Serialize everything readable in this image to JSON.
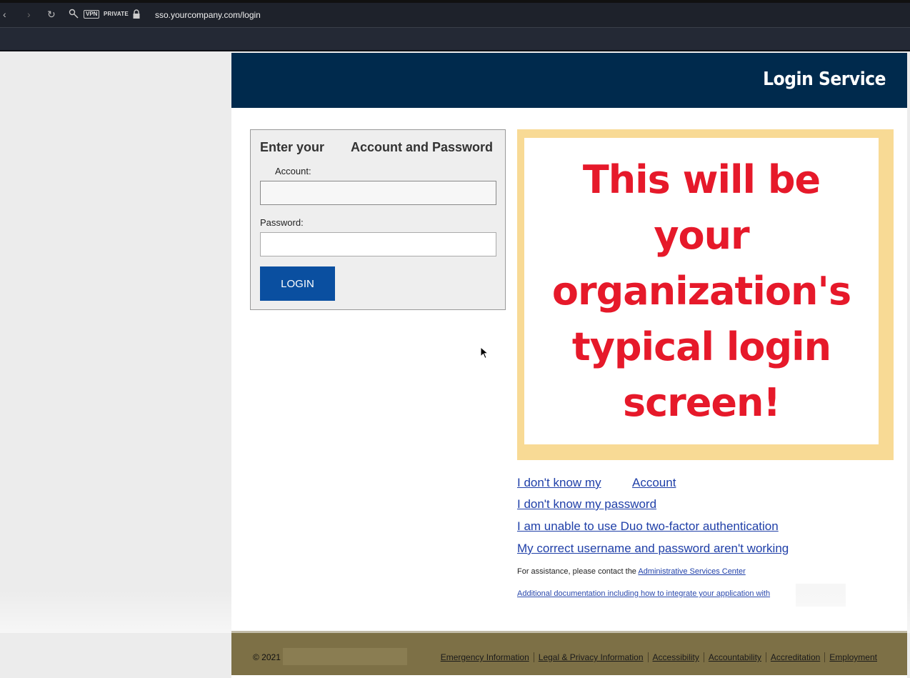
{
  "browser": {
    "vpn_label": "VPN",
    "private_label": "PRIVATE",
    "url": "sso.yourcompany.com/login"
  },
  "header": {
    "title": "Login Service"
  },
  "login": {
    "heading_part1": "Enter your",
    "heading_part2": "Account and Password",
    "account_label": "Account:",
    "account_value": "",
    "password_label": "Password:",
    "password_value": "",
    "button_label": "LOGIN"
  },
  "notice": {
    "text": "This will be your organization's typical login screen!"
  },
  "help_links": {
    "forgot_account_part1": "I don't know my ",
    "forgot_account_part2": "Account",
    "forgot_password": "I don't know my password",
    "duo": "I am unable to use Duo two-factor authentication",
    "not_working": "My correct username and password aren't working"
  },
  "assistance": {
    "text": "For assistance, please contact the ",
    "link": "Administrative Services Center",
    "doc_link": "Additional documentation including how to integrate your application with"
  },
  "footer": {
    "copyright": "© 2021",
    "links": [
      "Emergency Information",
      "Legal & Privacy Information",
      "Accessibility",
      "Accountability",
      "Accreditation",
      "Employment"
    ]
  },
  "colors": {
    "header_bg": "#002a4d",
    "notice_border": "#f8da95",
    "notice_text": "#e6192a",
    "button_bg": "#0a4fa0",
    "footer_bg": "#7d7046",
    "link": "#1f3fa8"
  }
}
